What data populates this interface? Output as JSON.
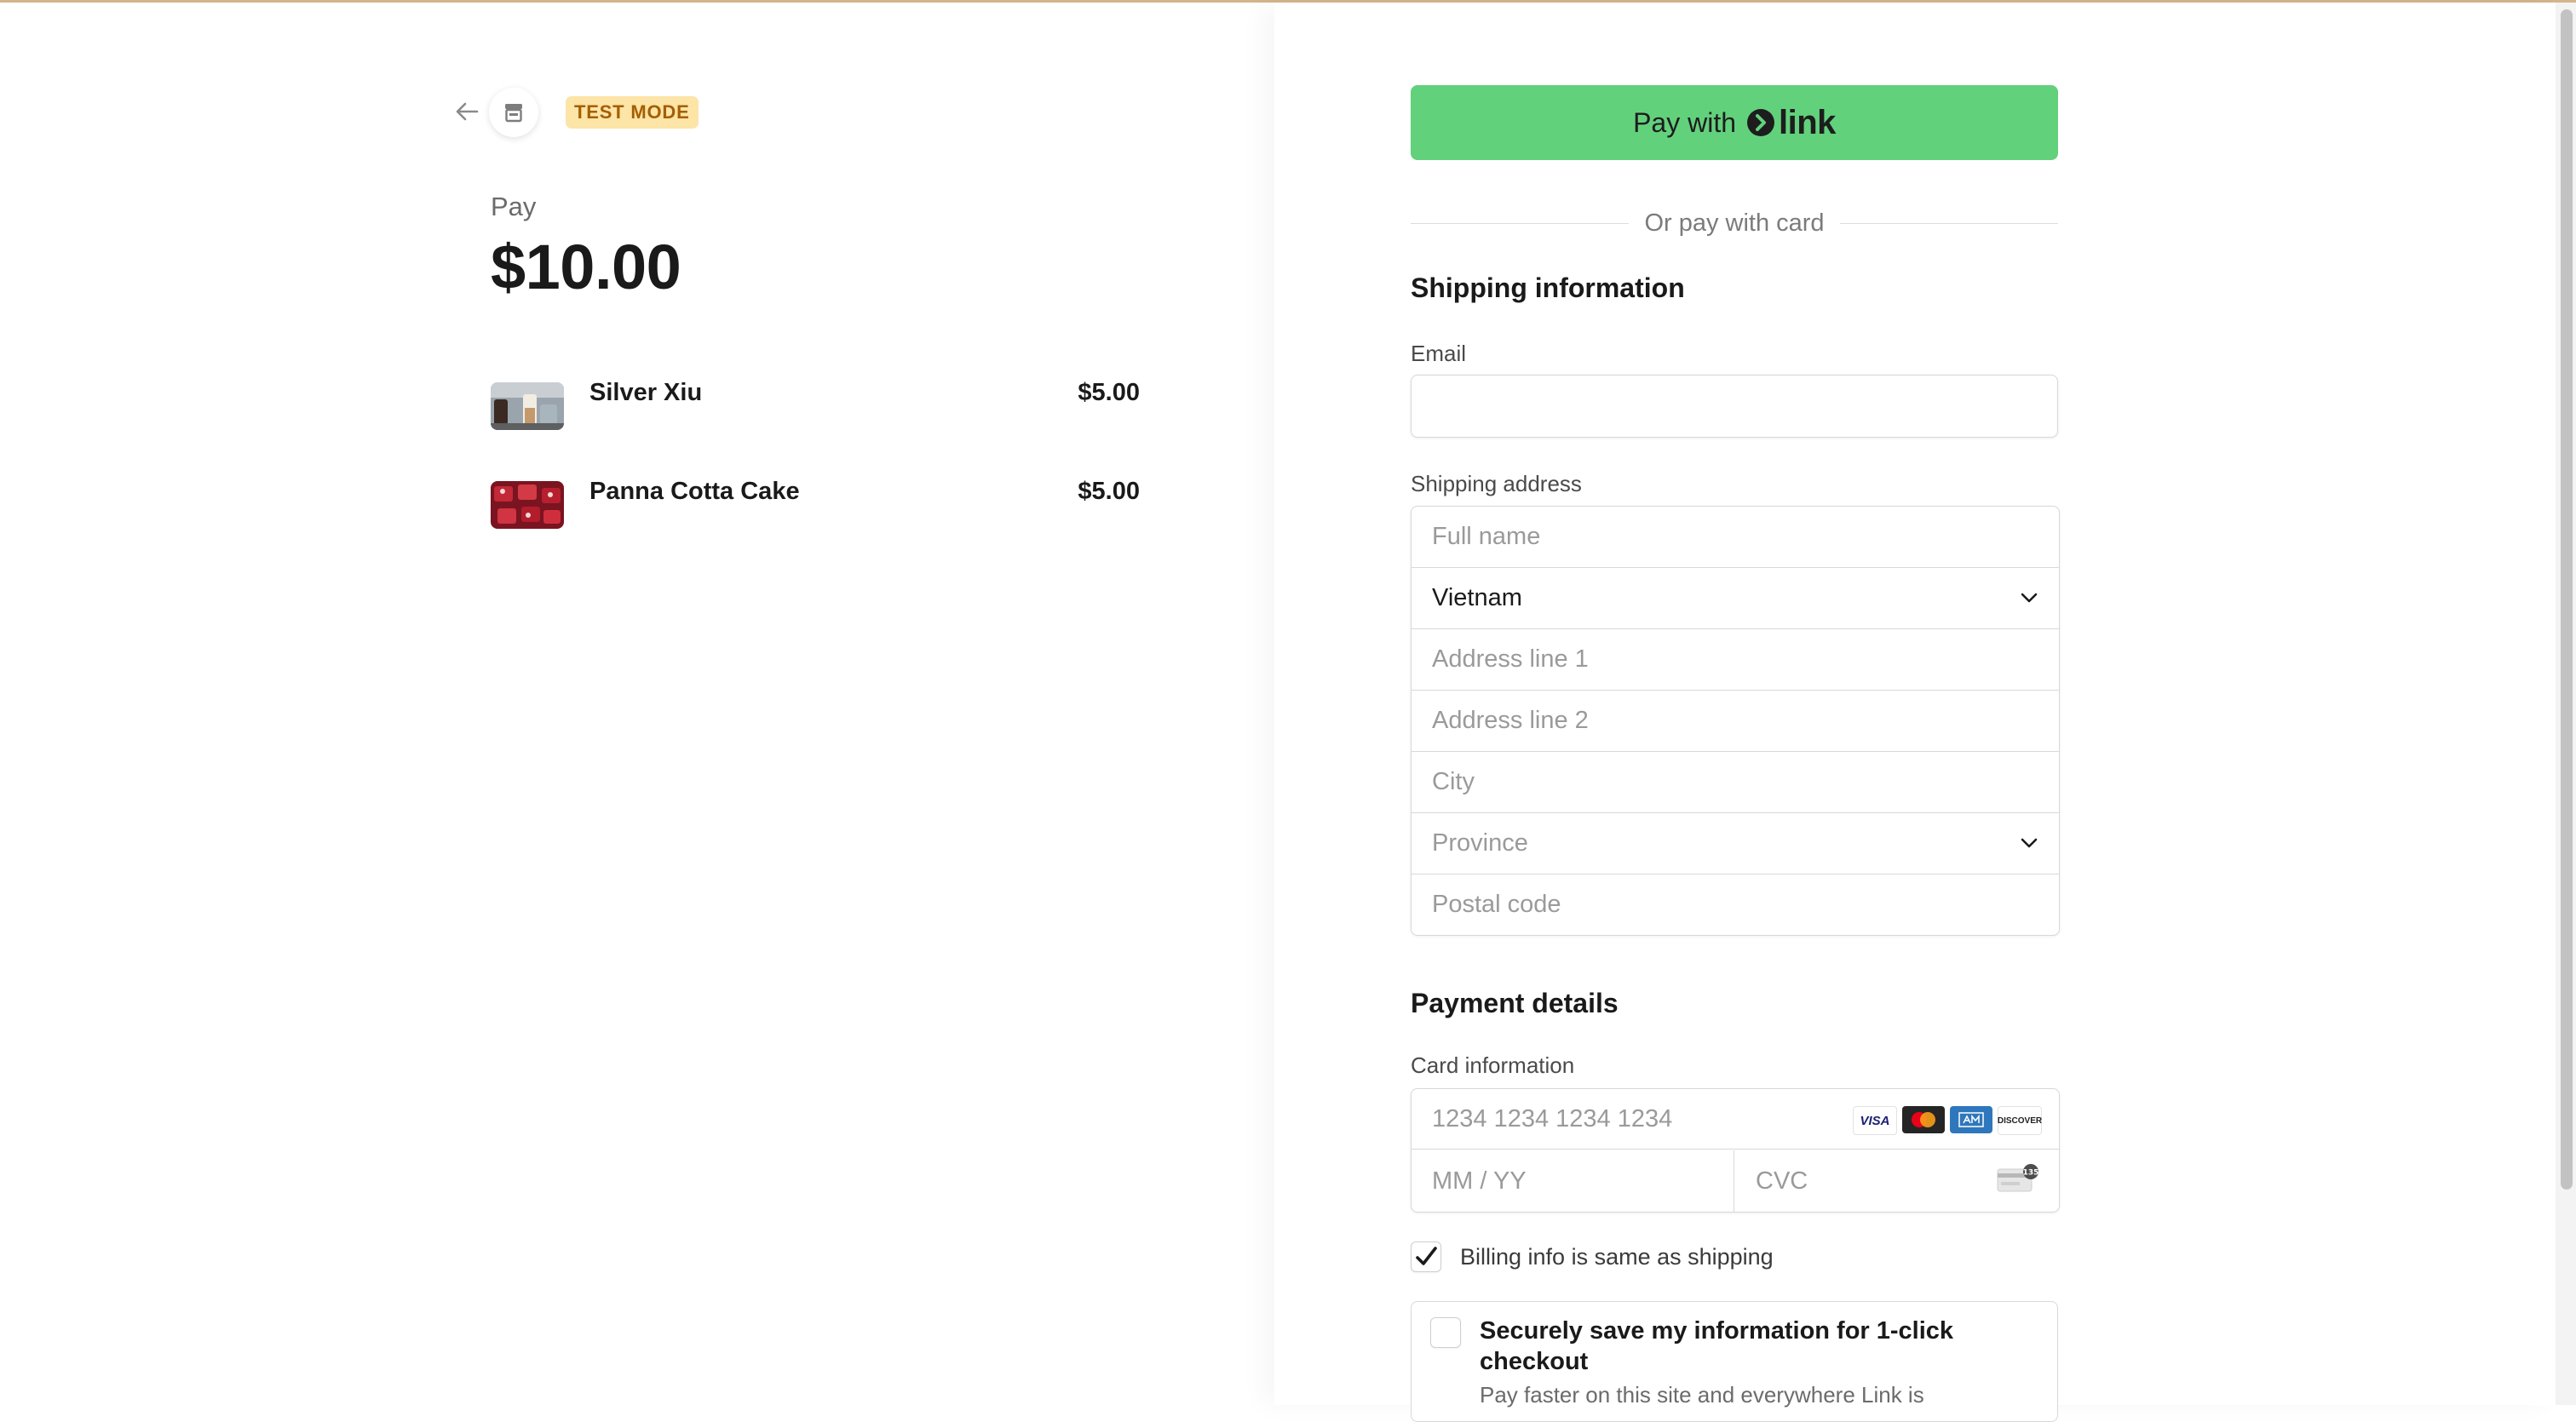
{
  "header": {
    "test_mode_badge": "TEST MODE"
  },
  "summary": {
    "pay_label": "Pay",
    "amount": "$10.00",
    "items": [
      {
        "name": "Silver Xiu",
        "price": "$5.00"
      },
      {
        "name": "Panna Cotta Cake",
        "price": "$5.00"
      }
    ]
  },
  "checkout": {
    "link_button": {
      "label": "Pay with",
      "logo_text": "link"
    },
    "divider_text": "Or pay with card",
    "shipping": {
      "title": "Shipping information",
      "email_label": "Email",
      "email_value": "",
      "address_label": "Shipping address",
      "full_name_placeholder": "Full name",
      "country_value": "Vietnam",
      "address1_placeholder": "Address line 1",
      "address2_placeholder": "Address line 2",
      "city_placeholder": "City",
      "province_placeholder": "Province",
      "postal_placeholder": "Postal code"
    },
    "payment": {
      "title": "Payment details",
      "card_label": "Card information",
      "card_number_placeholder": "1234 1234 1234 1234",
      "expiry_placeholder": "MM / YY",
      "cvc_placeholder": "CVC",
      "card_brands": [
        "VISA",
        "Mastercard",
        "American Express",
        "DISCOVER"
      ],
      "cvc_icon_text": "135"
    },
    "billing_same": {
      "label": "Billing info is same as shipping",
      "checked": true
    },
    "save_info": {
      "title": "Securely save my information for 1-click checkout",
      "subtitle": "Pay faster on this site and everywhere Link is",
      "checked": false
    }
  },
  "colors": {
    "link_green": "#62d17c",
    "badge_bg": "#fde4a7",
    "badge_text": "#a35f00"
  }
}
